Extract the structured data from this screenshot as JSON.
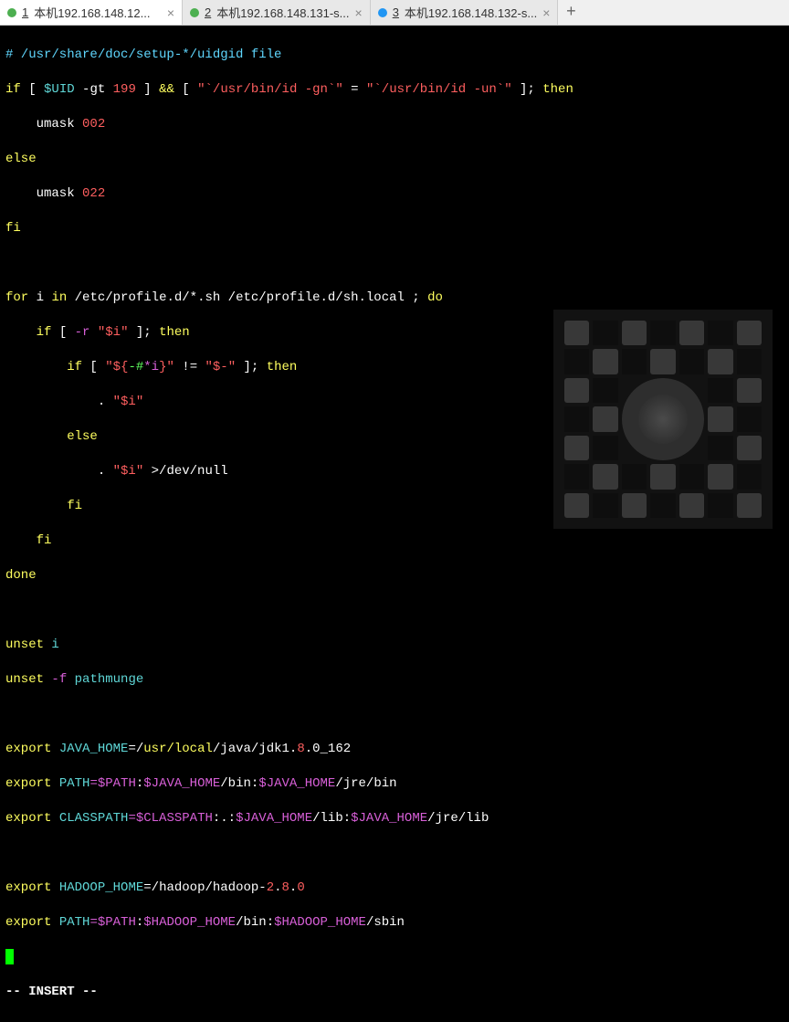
{
  "tabs": [
    {
      "num": "1",
      "label": "本机192.168.148.12...",
      "dot": "green",
      "active": true
    },
    {
      "num": "2",
      "label": "本机192.168.148.131-s...",
      "dot": "green",
      "active": false
    },
    {
      "num": "3",
      "label": "本机192.168.148.132-s...",
      "dot": "blue",
      "active": false
    }
  ],
  "code": {
    "l1": "# /usr/share/doc/setup-*/uidgid file",
    "l2a": "if",
    "l2b": " [ ",
    "l2c": "$UID",
    "l2d": " -gt ",
    "l2e": "199",
    "l2f": " ] ",
    "l2g": "&&",
    "l2h": " [ ",
    "l2i": "\"`/usr/bin/id -gn`\"",
    "l2j": " = ",
    "l2k": "\"`/usr/bin/id -un`\"",
    "l2l": " ]; ",
    "l2m": "then",
    "l3a": "    umask ",
    "l3b": "002",
    "l4": "else",
    "l5a": "    umask ",
    "l5b": "022",
    "l6": "fi",
    "l8a": "for",
    "l8b": " i ",
    "l8c": "in",
    "l8d": " /etc/profile.d/*.sh /etc/profile.d/sh.local ; ",
    "l8e": "do",
    "l9a": "    if",
    "l9b": " [ ",
    "l9c": "-r",
    "l9d": " ",
    "l9e": "\"$i\"",
    "l9f": " ]; ",
    "l9g": "then",
    "l10a": "        if",
    "l10b": " [ ",
    "l10c": "\"${",
    "l10d": "-#",
    "l10e": "*i",
    "l10f": "}\"",
    "l10g": " != ",
    "l10h": "\"$-\"",
    "l10i": " ]; ",
    "l10j": "then",
    "l11a": "            . ",
    "l11b": "\"$i\"",
    "l12": "        else",
    "l13a": "            . ",
    "l13b": "\"$i\"",
    "l13c": " >",
    "l13d": "/dev/null",
    "l14": "        fi",
    "l15": "    fi",
    "l16": "done",
    "l18a": "unset",
    "l18b": " i",
    "l19a": "unset",
    "l19b": " ",
    "l19c": "-f",
    "l19d": " pathmunge",
    "l21a": "export",
    "l21b": " ",
    "l21c": "JAVA_HOME",
    "l21d": "=/",
    "l21e": "usr/local",
    "l21f": "/java/jdk1.",
    "l21g": "8",
    "l21h": ".0_162",
    "l22a": "export",
    "l22b": " ",
    "l22c": "PATH",
    "l22d": "=$PATH",
    "l22e": ":",
    "l22f": "$JAVA_HOME",
    "l22g": "/bin:",
    "l22h": "$JAVA_HOME",
    "l22i": "/jre/bin",
    "l23a": "export",
    "l23b": " ",
    "l23c": "CLASSPATH",
    "l23d": "=$CLASSPATH",
    "l23e": ":.:",
    "l23f": "$JAVA_HOME",
    "l23g": "/lib:",
    "l23h": "$JAVA_HOME",
    "l23i": "/jre/lib",
    "l25a": "export",
    "l25b": " ",
    "l25c": "HADOOP_HOME",
    "l25d": "=/",
    "l25e": "hadoop/hadoop-",
    "l25f": "2",
    "l25g": ".",
    "l25h": "8",
    "l25i": ".",
    "l25j": "0",
    "l26a": "export",
    "l26b": " ",
    "l26c": "PATH",
    "l26d": "=$PATH",
    "l26e": ":",
    "l26f": "$HADOOP_HOME",
    "l26g": "/bin:",
    "l26h": "$HADOOP_HOME",
    "l26i": "/sbin"
  },
  "status": "-- INSERT --"
}
